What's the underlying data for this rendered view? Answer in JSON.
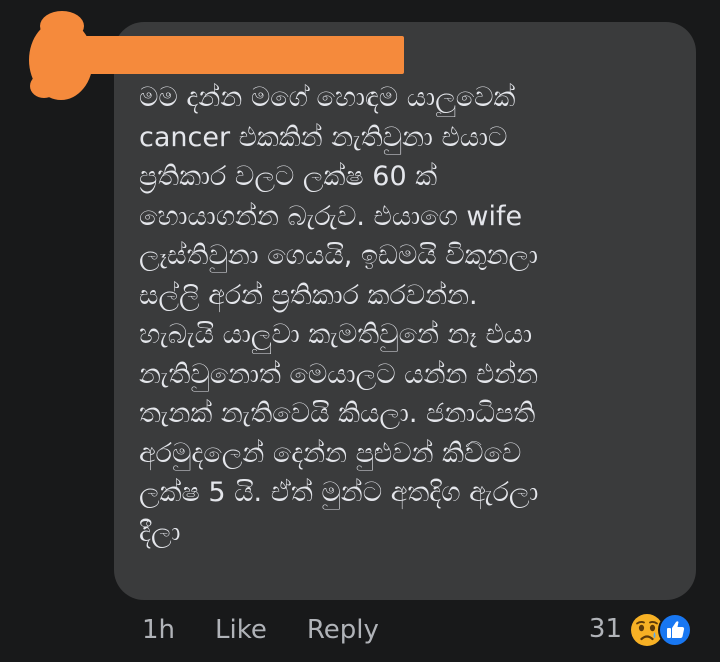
{
  "comment": {
    "author_redaction_color": "#f58a3c",
    "avatar_redaction_color": "#f58a3c",
    "text": "මම දන්න මගේ හොඳම යාලුවෙක්\ncancer එකකින් නැතිවුනා එයාට\nප්‍රතිකාර වලට ලක්ෂ 60 ක්\nහොයාගන්න බැරුව. එයාගෙ wife\nලෑස්තිවුනා ගෙයයි, ඉඩමයි විකුනලා\nසල්ලි අරන් ප්‍රතිකාර කරවන්න.\nහැබැයි යාලුවා කැමතිවුනේ නෑ එයා\nනැතිවුනොත් මෙයාලට යන්න එන්න\nතැනක් නැතිවෙයි කියලා. ජනාධිපති\nඅරමුදලෙන් දෙන්න පුළුවන් කිව්වෙ\nලක්ෂ 5 යි. ඒත් මුන්ට අතදිග ඇරලා\nදීලා",
    "bubble_color": "#3a3b3c",
    "text_color": "#e4e6eb"
  },
  "actions": {
    "timestamp": "1h",
    "like_label": "Like",
    "reply_label": "Reply",
    "text_color": "#b0b3b8"
  },
  "reactions": {
    "count": "31",
    "icons": [
      "sad-reaction-icon",
      "like-reaction-icon"
    ],
    "like_color": "#1877f2",
    "sad_color": "#f7b125"
  }
}
